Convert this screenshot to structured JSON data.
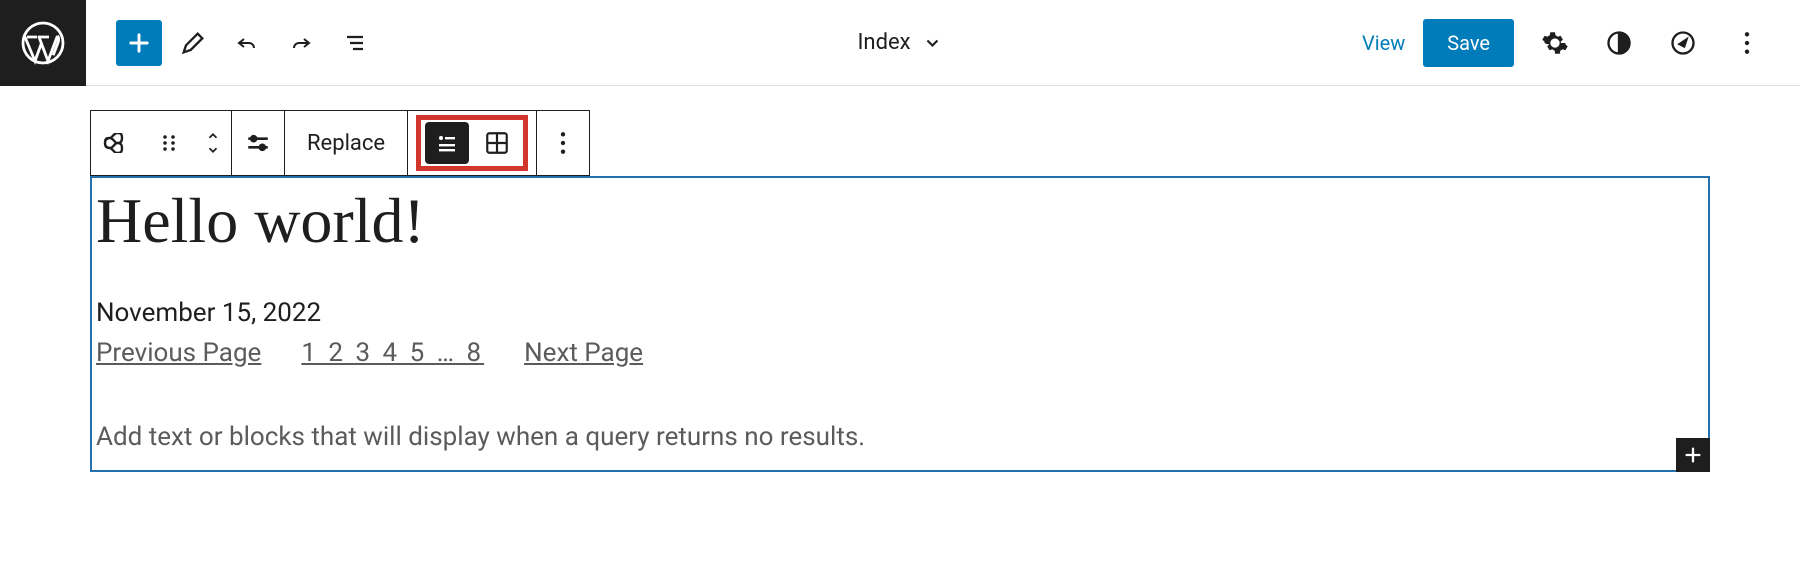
{
  "header": {
    "document_title": "Index",
    "view_label": "View",
    "save_label": "Save"
  },
  "toolbar": {
    "replace_label": "Replace"
  },
  "post": {
    "title": "Hello world!",
    "date": "November 15, 2022"
  },
  "pagination": {
    "previous_label": "Previous Page",
    "pages_text": "1 2 3 4 5 … 8",
    "next_label": "Next Page"
  },
  "no_results_placeholder": "Add text or blocks that will display when a query returns no results."
}
